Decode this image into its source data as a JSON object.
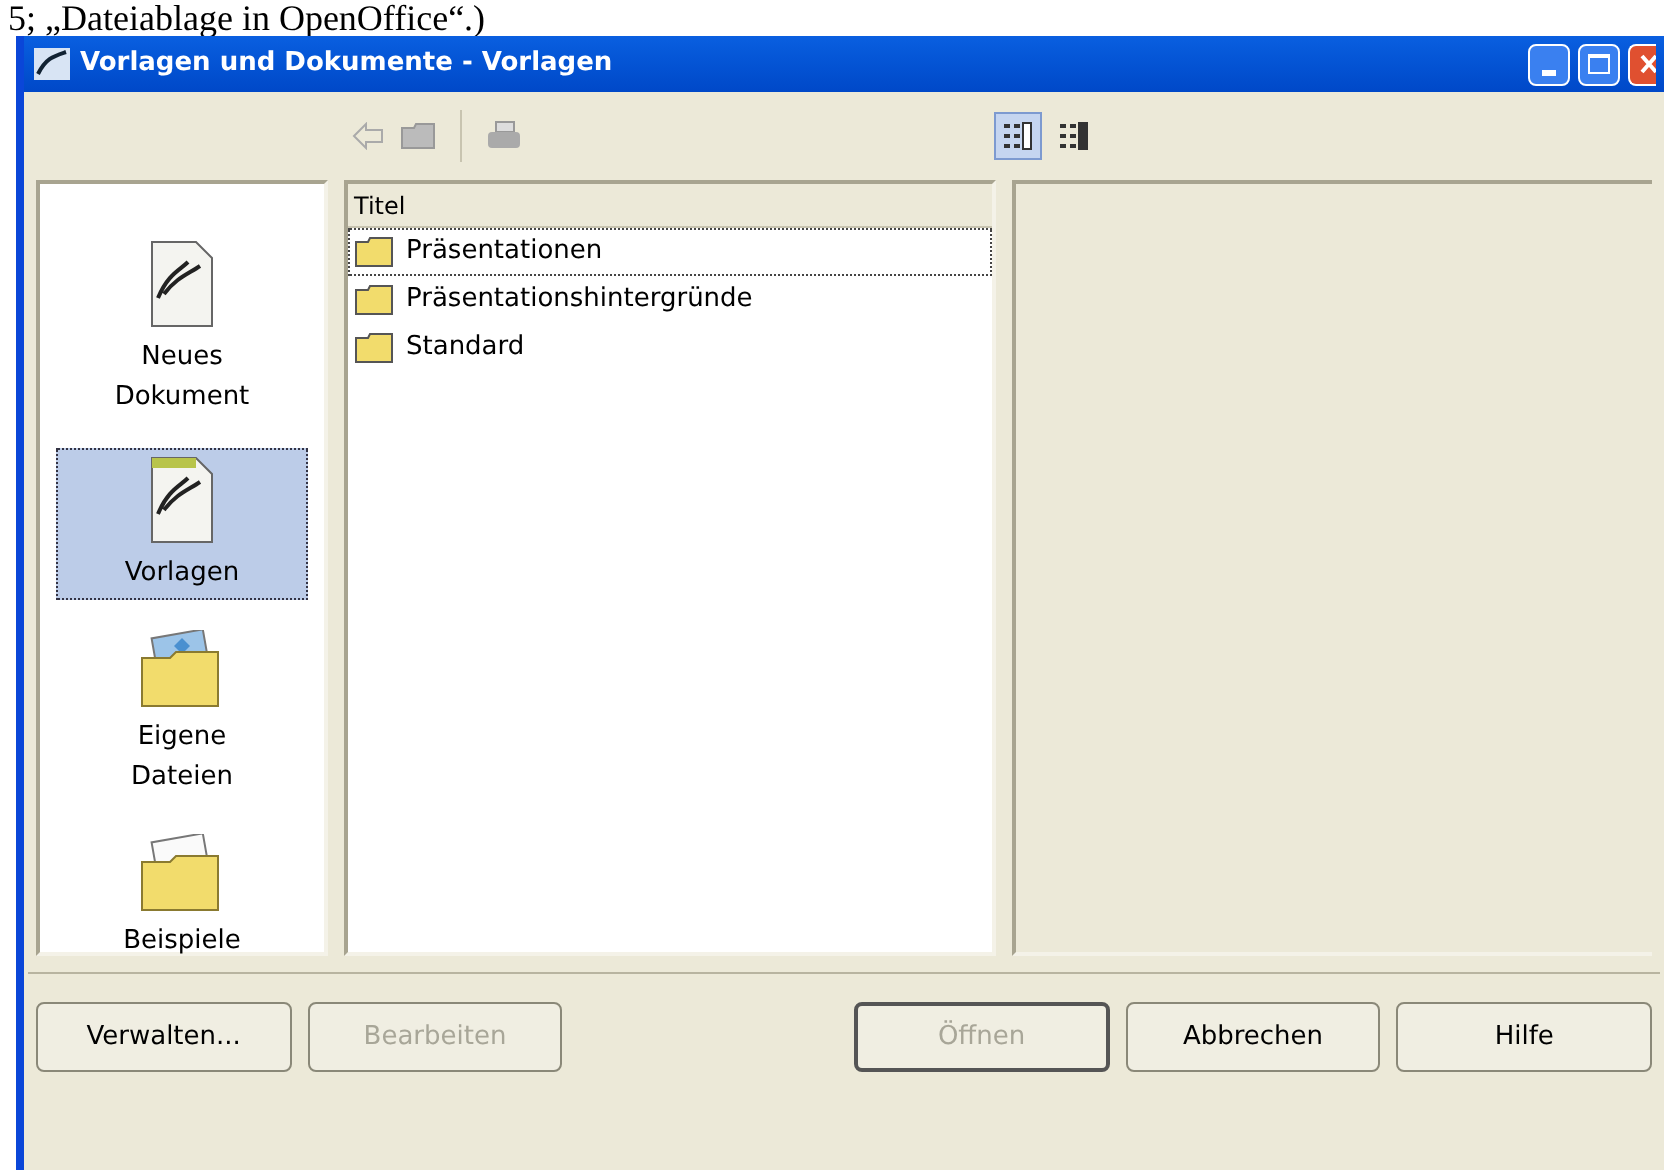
{
  "caption": "5; „Dateiablage in OpenOffice“.)",
  "window": {
    "title": "Vorlagen und Dokumente - Vorlagen"
  },
  "toolbar": {
    "view_buttons": [
      {
        "kind": "details",
        "selected": true
      },
      {
        "kind": "preview",
        "selected": false
      }
    ]
  },
  "sidebar": {
    "items": [
      {
        "kind": "document",
        "label": "Neues Dokument",
        "selected": false
      },
      {
        "kind": "template",
        "label": "Vorlagen",
        "selected": true
      },
      {
        "kind": "photo-folder",
        "label": "Eigene Dateien",
        "selected": false
      },
      {
        "kind": "folder",
        "label": "Beispiele",
        "selected": false
      }
    ]
  },
  "list": {
    "column": "Titel",
    "rows": [
      {
        "label": "Präsentationen",
        "selected": true
      },
      {
        "label": "Präsentationshintergründe",
        "selected": false
      },
      {
        "label": "Standard",
        "selected": false
      }
    ]
  },
  "buttons": [
    {
      "label": "Verwalten...",
      "disabled": false
    },
    {
      "label": "Bearbeiten",
      "disabled": true
    },
    {
      "label": "Öffnen",
      "disabled": true
    },
    {
      "label": "Abbrechen",
      "disabled": false
    },
    {
      "label": "Hilfe",
      "disabled": false
    }
  ]
}
